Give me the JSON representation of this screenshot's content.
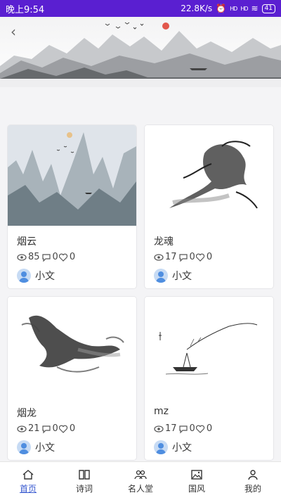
{
  "status_bar": {
    "time": "晚上9:54",
    "speed": "22.8K/s",
    "signal1": "HD",
    "signal2": "HD",
    "battery": "41"
  },
  "banner": {
    "back_icon": "chevron-left-icon"
  },
  "cards": [
    {
      "title": "烟云",
      "views": "85",
      "comments": "0",
      "likes": "0",
      "author": "小文"
    },
    {
      "title": "龙魂",
      "views": "17",
      "comments": "0",
      "likes": "0",
      "author": "小文"
    },
    {
      "title": "烟龙",
      "views": "21",
      "comments": "0",
      "likes": "0",
      "author": "小文"
    },
    {
      "title": "mz",
      "views": "17",
      "comments": "0",
      "likes": "0",
      "author": "小文"
    }
  ],
  "tabs": [
    {
      "label": "首页",
      "icon": "home-icon",
      "active": true
    },
    {
      "label": "诗词",
      "icon": "book-icon",
      "active": false
    },
    {
      "label": "名人堂",
      "icon": "people-icon",
      "active": false
    },
    {
      "label": "国风",
      "icon": "image-icon",
      "active": false
    },
    {
      "label": "我的",
      "icon": "person-icon",
      "active": false
    }
  ],
  "colors": {
    "status_bar": "#5a1fd1",
    "active_tab": "#3a5bd0"
  }
}
